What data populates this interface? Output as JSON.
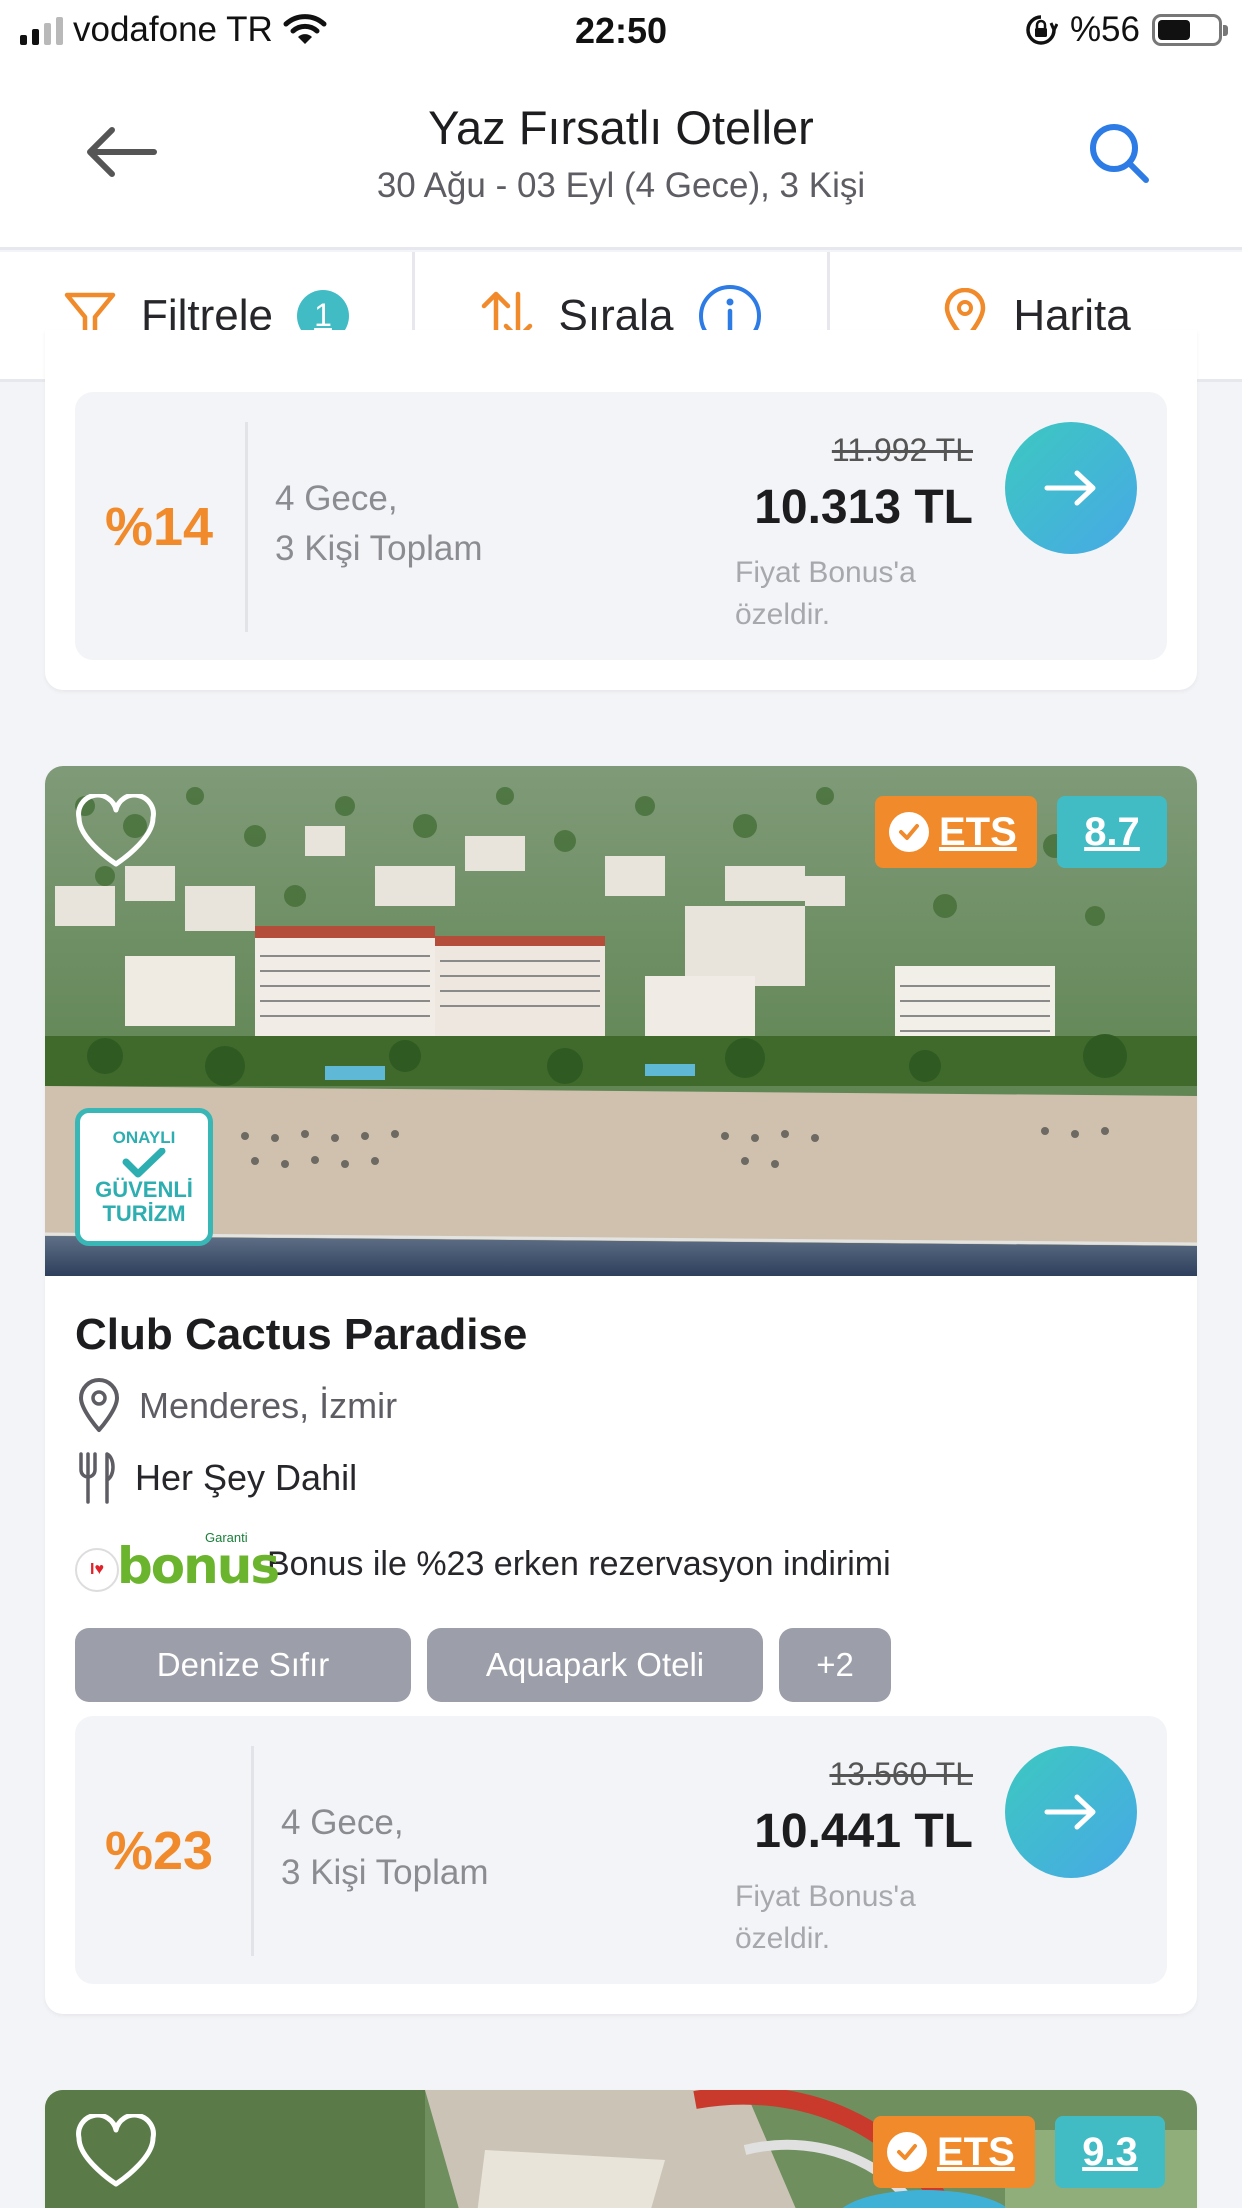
{
  "status_bar": {
    "carrier": "vodafone TR",
    "time": "22:50",
    "battery": "%56",
    "battery_level": 0.56
  },
  "header": {
    "title": "Yaz Fırsatlı Oteller",
    "subtitle": "30 Ağu - 03 Eyl (4 Gece), 3 Kişi",
    "back_icon": "arrow-left-icon",
    "search_icon": "search-icon"
  },
  "toolbar": {
    "filter_label": "Filtrele",
    "filter_count": "1",
    "sort_label": "Sırala",
    "map_label": "Harita"
  },
  "cards": [
    {
      "discount": "%14",
      "nights_line1": "4 Gece,",
      "nights_line2": "3 Kişi Toplam",
      "old_price": "11.992 TL",
      "new_price": "10.313 TL",
      "note_line1": "Fiyat Bonus'a",
      "note_line2": "özeldir."
    },
    {
      "name": "Club Cactus Paradise",
      "location": "Menderes, İzmir",
      "board": "Her Şey Dahil",
      "ets_label": "ETS",
      "score": "8.7",
      "safe_badge_line1": "ONAYLI",
      "safe_badge_line2": "GÜVENLİ",
      "safe_badge_line3": "TURİZM",
      "bonus_logo_text": "bonus",
      "bonus_logo_brand": "Garanti",
      "bonus_text": "Bonus ile %23 erken rezervasyon indirimi",
      "tags": [
        "Denize Sıfır",
        "Aquapark Oteli",
        "+2"
      ],
      "discount": "%23",
      "nights_line1": "4 Gece,",
      "nights_line2": "3 Kişi Toplam",
      "old_price": "13.560 TL",
      "new_price": "10.441 TL",
      "note_line1": "Fiyat Bonus'a",
      "note_line2": "özeldir."
    },
    {
      "ets_label": "ETS",
      "score": "9.3"
    }
  ],
  "colors": {
    "accent_orange": "#f08a2a",
    "accent_teal": "#42bcc4",
    "link_blue": "#2d7be5",
    "tag_gray": "#9c9fa9"
  }
}
